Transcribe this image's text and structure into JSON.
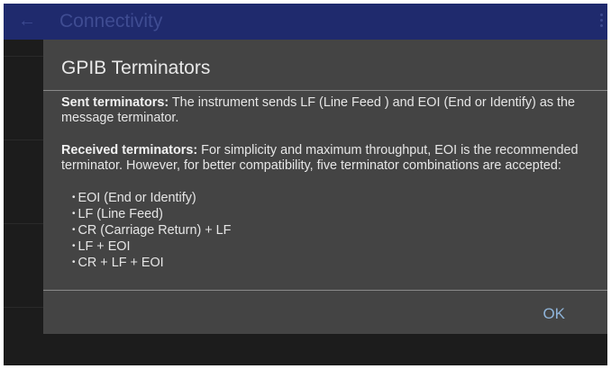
{
  "appbar": {
    "title": "Connectivity",
    "back_icon": "arrow-left-icon",
    "overflow_icon": "more-vert-icon",
    "color": "#1f2a6d"
  },
  "dialog": {
    "title": "GPIB Terminators",
    "sent_heading": "Sent terminators:",
    "sent_text": " The instrument sends LF (Line Feed ) and EOI (End or Identify) as the message terminator.",
    "received_heading": "Received terminators:",
    "received_text": " For simplicity and maximum throughput, EOI is the recommended terminator. However, for better compatibility, five terminator combinations are accepted:",
    "bullets": [
      "EOI (End or Identify)",
      "LF (Line Feed)",
      "CR (Carriage Return) + LF",
      "LF + EOI",
      "CR + LF + EOI"
    ],
    "ok_label": "OK",
    "accent": "#8fb4d9"
  }
}
